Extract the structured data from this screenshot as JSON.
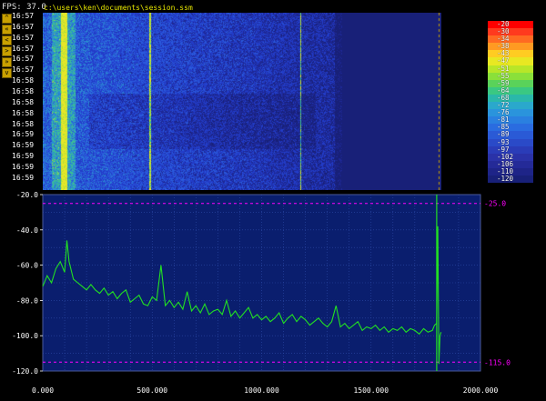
{
  "header": {
    "fps_text": "FPS: 37.0",
    "file_path": "c:\\users\\ken\\documents\\session.ssm"
  },
  "nav_buttons": [
    "^",
    "«",
    "<",
    ">",
    "»",
    "v"
  ],
  "timestamps": [
    "16:57",
    "16:57",
    "16:57",
    "16:57",
    "16:57",
    "16:57",
    "16:58",
    "16:58",
    "16:58",
    "16:58",
    "16:58",
    "16:59",
    "16:59",
    "16:59",
    "16:59",
    "16:59"
  ],
  "colors": {
    "background": "#000000",
    "plot_bg": "#0a1e6e",
    "trace": "#22e022",
    "marker": "#ff00ff",
    "path_text": "#e6e600",
    "nav_button": "#c8a000"
  },
  "legend": {
    "values": [
      "-20",
      "-30",
      "-34",
      "-38",
      "-43",
      "-47",
      "-51",
      "-55",
      "-59",
      "-64",
      "-68",
      "-72",
      "-76",
      "-81",
      "-85",
      "-89",
      "-93",
      "-97",
      "-102",
      "-106",
      "-110",
      "-120"
    ],
    "colors": [
      "#ff0000",
      "#ff3a1e",
      "#ff6a22",
      "#ff9a22",
      "#ffcc22",
      "#e8e822",
      "#b8e628",
      "#8ae03a",
      "#5ad25a",
      "#3ac882",
      "#2ab8aa",
      "#2aa8cc",
      "#2a94dc",
      "#2a80e0",
      "#2a6ce0",
      "#2a5ad6",
      "#2a4ac8",
      "#2a3cb8",
      "#2a32a8",
      "#242a98",
      "#1e2488",
      "#182078"
    ]
  },
  "markers": {
    "top_label": "-25.0",
    "bottom_label": "-115.0",
    "top_value": -25,
    "bottom_value": -115
  },
  "chart_data": {
    "type": "line",
    "title": "",
    "xlabel": "",
    "ylabel": "",
    "xlim": [
      0,
      2000
    ],
    "ylim": [
      -120,
      -20
    ],
    "x_ticks": [
      "0.000",
      "500.000",
      "1000.000",
      "1500.000",
      "2000.000"
    ],
    "x_tick_values": [
      0,
      500,
      1000,
      1500,
      2000
    ],
    "y_ticks": [
      "-20.0",
      "-40.0",
      "-60.0",
      "-80.0",
      "-100.0",
      "-120.0"
    ],
    "y_tick_values": [
      -20,
      -40,
      -60,
      -80,
      -100,
      -120
    ],
    "series": [
      {
        "x": [
          0,
          20,
          40,
          60,
          80,
          100,
          110,
          120,
          140,
          160,
          180,
          200,
          220,
          240,
          260,
          280,
          300,
          320,
          340,
          360,
          380,
          400,
          420,
          440,
          460,
          480,
          500,
          520,
          540,
          560,
          580,
          600,
          620,
          640,
          660,
          680,
          700,
          720,
          740,
          760,
          780,
          800,
          820,
          840,
          860,
          880,
          900,
          920,
          940,
          960,
          980,
          1000,
          1020,
          1040,
          1060,
          1080,
          1100,
          1120,
          1140,
          1160,
          1180,
          1200,
          1220,
          1240,
          1260,
          1280,
          1300,
          1320,
          1340,
          1360,
          1380,
          1400,
          1420,
          1440,
          1460,
          1480,
          1500,
          1520,
          1540,
          1560,
          1580,
          1600,
          1620,
          1640,
          1660,
          1680,
          1700,
          1720,
          1740,
          1760,
          1780,
          1790,
          1800,
          1805,
          1810,
          1815,
          1820
        ],
        "y": [
          -72,
          -66,
          -70,
          -62,
          -58,
          -64,
          -46,
          -58,
          -68,
          -70,
          -72,
          -74,
          -71,
          -74,
          -76,
          -73,
          -77,
          -75,
          -79,
          -76,
          -74,
          -81,
          -79,
          -77,
          -82,
          -83,
          -78,
          -80,
          -60,
          -83,
          -80,
          -84,
          -81,
          -85,
          -75,
          -86,
          -83,
          -87,
          -82,
          -88,
          -86,
          -85,
          -88,
          -80,
          -89,
          -86,
          -90,
          -87,
          -84,
          -90,
          -88,
          -91,
          -89,
          -92,
          -90,
          -87,
          -93,
          -90,
          -88,
          -92,
          -89,
          -91,
          -94,
          -92,
          -90,
          -93,
          -95,
          -92,
          -83,
          -95,
          -93,
          -96,
          -94,
          -92,
          -97,
          -95,
          -96,
          -94,
          -97,
          -95,
          -98,
          -96,
          -97,
          -95,
          -98,
          -96,
          -97,
          -99,
          -96,
          -98,
          -97,
          -94,
          -93,
          -38,
          -116,
          -100,
          -98
        ]
      }
    ]
  }
}
